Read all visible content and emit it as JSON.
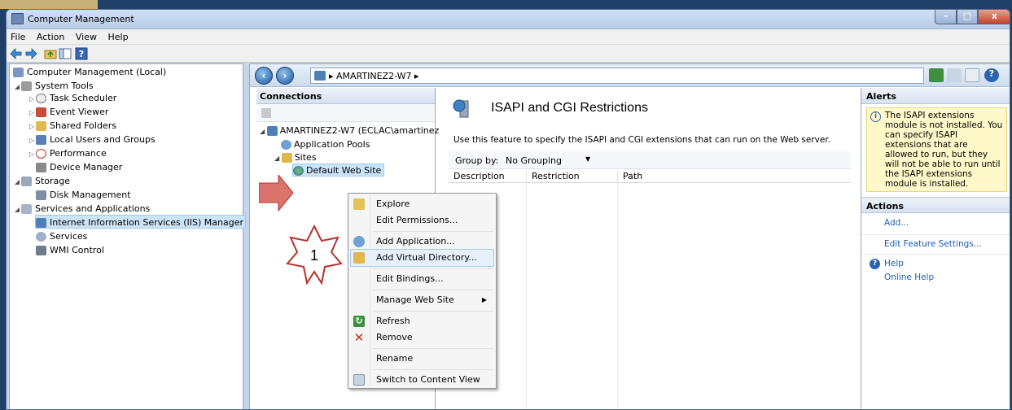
{
  "window": {
    "title": "Computer Management",
    "controls": {
      "minimize": "–",
      "maximize": "□",
      "close": "x"
    }
  },
  "menu": [
    "File",
    "Action",
    "View",
    "Help"
  ],
  "tree": {
    "root": "Computer Management (Local)",
    "items": [
      {
        "label": "System Tools",
        "level": 1,
        "expander": "open",
        "icon": "tools-icon"
      },
      {
        "label": "Task Scheduler",
        "level": 2,
        "expander": "closed",
        "icon": "clock-icon"
      },
      {
        "label": "Event Viewer",
        "level": 2,
        "expander": "closed",
        "icon": "event-viewer-icon"
      },
      {
        "label": "Shared Folders",
        "level": 2,
        "expander": "closed",
        "icon": "shared-folder-icon"
      },
      {
        "label": "Local Users and Groups",
        "level": 2,
        "expander": "closed",
        "icon": "users-icon"
      },
      {
        "label": "Performance",
        "level": 2,
        "expander": "closed",
        "icon": "performance-icon"
      },
      {
        "label": "Device Manager",
        "level": 2,
        "expander": "none",
        "icon": "device-manager-icon"
      },
      {
        "label": "Storage",
        "level": 1,
        "expander": "open",
        "icon": "storage-icon"
      },
      {
        "label": "Disk Management",
        "level": 2,
        "expander": "none",
        "icon": "disk-icon"
      },
      {
        "label": "Services and Applications",
        "level": 1,
        "expander": "open",
        "icon": "services-apps-icon"
      },
      {
        "label": "Internet Information Services (IIS) Manager",
        "level": 2,
        "expander": "none",
        "icon": "iis-icon",
        "selected": true
      },
      {
        "label": "Services",
        "level": 2,
        "expander": "none",
        "icon": "services-icon"
      },
      {
        "label": "WMI Control",
        "level": 2,
        "expander": "none",
        "icon": "wmi-icon"
      }
    ]
  },
  "iis": {
    "breadcrumb": "AMARTINEZ2-W7",
    "connections": {
      "header": "Connections",
      "server": "AMARTINEZ2-W7 (ECLAC\\amartinez",
      "app_pools": "Application Pools",
      "sites": "Sites",
      "site": "Default Web Site"
    },
    "feature": {
      "title": "ISAPI and CGI Restrictions",
      "description": "Use this feature to specify the ISAPI and CGI extensions that can run on the Web server.",
      "group_by_label": "Group by:",
      "group_by_value": "No Grouping",
      "columns": [
        "Description",
        "Restriction",
        "Path"
      ]
    },
    "alerts": {
      "header": "Alerts",
      "message": "The ISAPI extensions module is not installed. You can specify ISAPI extensions that are allowed to run, but they will not be able to run until the ISAPI extensions module is installed."
    },
    "actions": {
      "header": "Actions",
      "add": "Add...",
      "edit_feature": "Edit Feature Settings...",
      "help": "Help",
      "online_help": "Online Help"
    }
  },
  "context_menu": [
    {
      "label": "Explore",
      "icon": "explore-icon"
    },
    {
      "label": "Edit Permissions...",
      "icon": ""
    },
    {
      "label": "Add Application...",
      "icon": "add-application-icon"
    },
    {
      "label": "Add Virtual Directory...",
      "icon": "add-virtual-directory-icon",
      "highlighted": true
    },
    {
      "label": "Edit Bindings...",
      "icon": ""
    },
    {
      "label": "Manage Web Site",
      "icon": "",
      "submenu": true
    },
    {
      "label": "Refresh",
      "icon": "refresh-icon"
    },
    {
      "label": "Remove",
      "icon": "remove-icon"
    },
    {
      "label": "Rename",
      "icon": ""
    },
    {
      "label": "Switch to Content View",
      "icon": "content-view-icon"
    }
  ],
  "annotation": {
    "step_number": "1",
    "arrow_color": "#d9736b",
    "star_color": "#b5332a"
  },
  "colors": {
    "highlight": "#cce4f7",
    "link": "#1e5eb3",
    "alert_bg": "#fff9c9"
  }
}
